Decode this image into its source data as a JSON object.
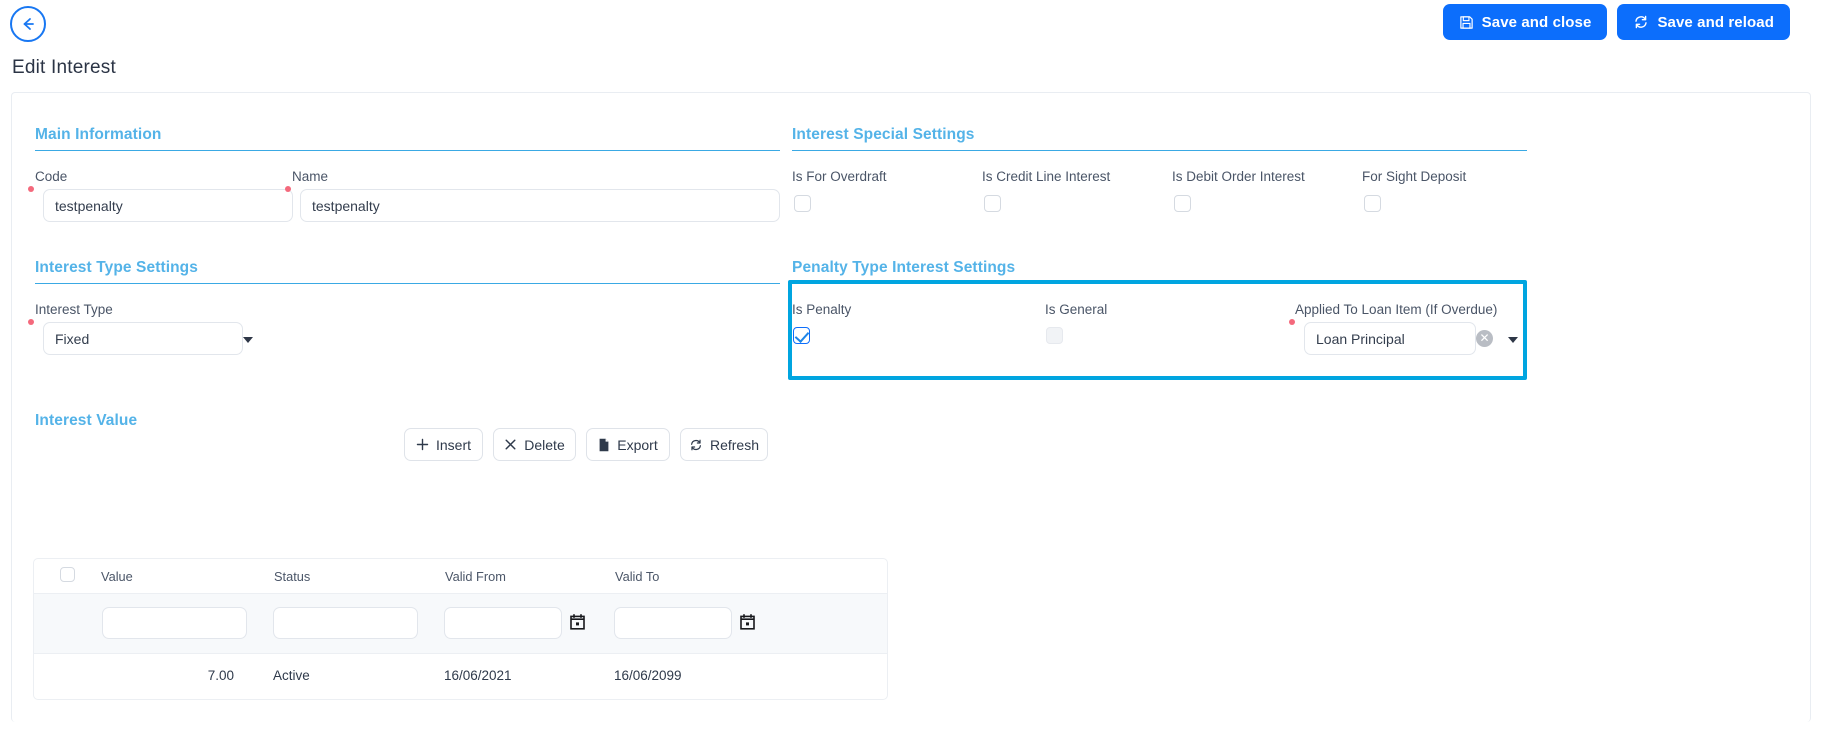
{
  "topbar": {
    "back_icon": "arrow-left-circle-icon",
    "buttons": [
      {
        "label": "Save and close",
        "icon": "floppy-disk-icon",
        "color": "#0c6efc"
      },
      {
        "label": "Save and reload",
        "icon": "sync-icon",
        "color": "#0c6efc"
      }
    ]
  },
  "page": {
    "title": "Edit Interest"
  },
  "sections": {
    "main_information": {
      "heading": "Main Information",
      "fields": [
        {
          "label": "Code",
          "value": "testpenalty",
          "required": true
        },
        {
          "label": "Name",
          "value": "testpenalty",
          "required": true
        }
      ]
    },
    "interest_type_settings": {
      "heading": "Interest Type Settings",
      "field": {
        "label": "Interest Type",
        "value": "Fixed",
        "required": true
      }
    },
    "interest_special_settings": {
      "heading": "Interest Special Settings",
      "checkboxes": [
        {
          "label": "Is For Overdraft",
          "checked": false
        },
        {
          "label": "Is Credit Line Interest",
          "checked": false
        },
        {
          "label": "Is Debit Order Interest",
          "checked": false
        },
        {
          "label": "For Sight Deposit",
          "checked": false
        }
      ]
    },
    "penalty_type_interest_settings": {
      "heading": "Penalty Type Interest Settings",
      "highlighted": true,
      "highlight_color": "#00a5e0",
      "is_penalty": {
        "label": "Is Penalty",
        "checked": true,
        "disabled": false
      },
      "is_general": {
        "label": "Is General",
        "checked": false,
        "disabled": true
      },
      "applied_to": {
        "label": "Applied To Loan Item (If Overdue)",
        "value": "Loan Principal",
        "required": true
      }
    },
    "interest_value": {
      "heading": "Interest Value",
      "toolbar": [
        {
          "label": "Insert",
          "icon": "plus-icon"
        },
        {
          "label": "Delete",
          "icon": "x-icon"
        },
        {
          "label": "Export",
          "icon": "file-icon"
        },
        {
          "label": "Refresh",
          "icon": "refresh-icon"
        }
      ],
      "grid": {
        "columns": [
          "Value",
          "Status",
          "Valid From",
          "Valid To"
        ],
        "filters": [
          {
            "placeholder": "",
            "has_calendar": false
          },
          {
            "placeholder": "",
            "has_calendar": false
          },
          {
            "placeholder": "",
            "has_calendar": true
          },
          {
            "placeholder": "",
            "has_calendar": true
          }
        ],
        "rows": [
          {
            "value": "7.00",
            "status": "Active",
            "valid_from": "16/06/2021",
            "valid_to": "16/06/2099"
          }
        ]
      }
    }
  }
}
